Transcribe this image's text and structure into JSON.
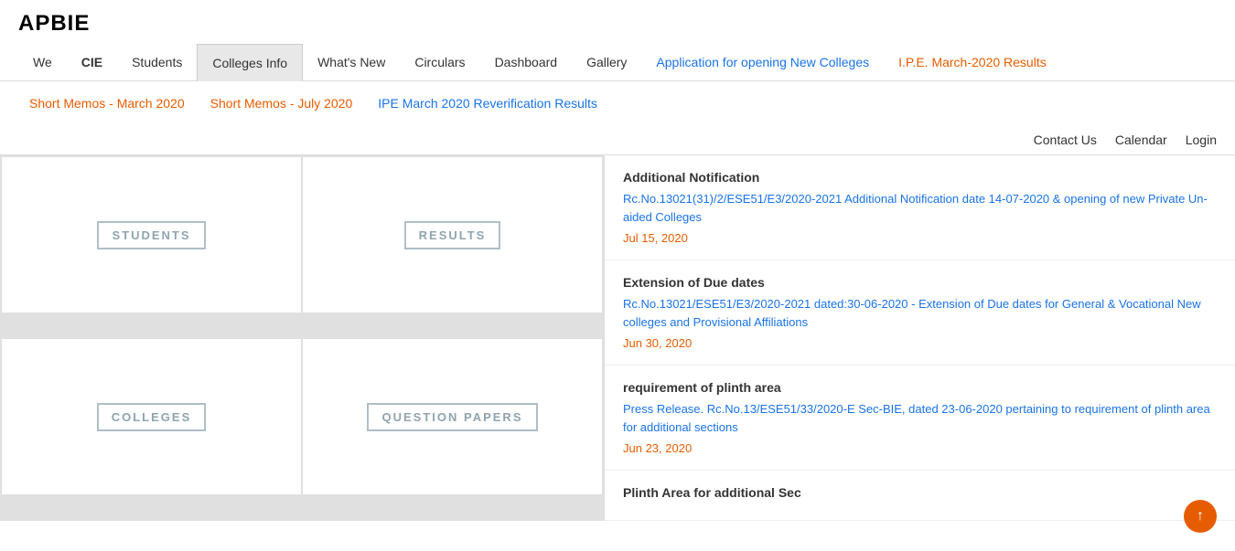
{
  "header": {
    "logo": "APBIE"
  },
  "primaryNav": {
    "items": [
      {
        "id": "we",
        "label": "We",
        "style": "normal",
        "active": false
      },
      {
        "id": "cie",
        "label": "CIE",
        "style": "bold",
        "active": false
      },
      {
        "id": "students",
        "label": "Students",
        "style": "normal",
        "active": false
      },
      {
        "id": "colleges-info",
        "label": "Colleges Info",
        "style": "normal",
        "active": true
      },
      {
        "id": "whats-new",
        "label": "What's New",
        "style": "normal",
        "active": false
      },
      {
        "id": "circulars",
        "label": "Circulars",
        "style": "normal",
        "active": false
      },
      {
        "id": "dashboard",
        "label": "Dashboard",
        "style": "normal",
        "active": false
      },
      {
        "id": "gallery",
        "label": "Gallery",
        "style": "normal",
        "active": false
      },
      {
        "id": "application-new-colleges",
        "label": "Application for opening New Colleges",
        "style": "blue",
        "active": false
      },
      {
        "id": "ipe-results",
        "label": "I.P.E. March-2020 Results",
        "style": "orange",
        "active": false
      }
    ]
  },
  "secondaryNav": {
    "items": [
      {
        "id": "short-memos-march",
        "label": "Short Memos - March 2020",
        "style": "orange"
      },
      {
        "id": "short-memos-july",
        "label": "Short Memos - July 2020",
        "style": "orange"
      },
      {
        "id": "ipe-reverification",
        "label": "IPE March 2020 Reverification Results",
        "style": "blue"
      }
    ]
  },
  "utilityNav": {
    "items": [
      {
        "id": "contact-us",
        "label": "Contact Us"
      },
      {
        "id": "calendar",
        "label": "Calendar"
      },
      {
        "id": "login",
        "label": "Login"
      }
    ]
  },
  "grid": {
    "cards": [
      {
        "id": "students",
        "label": "STUDENTS"
      },
      {
        "id": "results",
        "label": "RESULTS"
      },
      {
        "id": "colleges",
        "label": "COLLEGES"
      },
      {
        "id": "question-papers",
        "label": "QUESTION PAPERS"
      }
    ]
  },
  "news": {
    "items": [
      {
        "id": "additional-notification",
        "title": "Additional Notification",
        "desc": "Rc.No.13021(31)/2/ESE51/E3/2020-2021 Additional Notification date 14-07-2020 & opening of new Private Un-aided Colleges",
        "date": "Jul 15, 2020"
      },
      {
        "id": "extension-due-dates",
        "title": "Extension of Due dates",
        "desc": "Rc.No.13021/ESE51/E3/2020-2021 dated:30-06-2020 - Extension of Due dates for General & Vocational New colleges and Provisional Affiliations",
        "date": "Jun 30, 2020"
      },
      {
        "id": "requirement-plinth-area",
        "title": "requirement of plinth area",
        "desc": "Press Release. Rc.No.13/ESE51/33/2020-E Sec-BIE, dated 23-06-2020 pertaining to requirement of plinth area for additional sections",
        "date": "Jun 23, 2020"
      },
      {
        "id": "plinth-area-additional",
        "title": "Plinth Area for additional Sec",
        "desc": "",
        "date": ""
      }
    ]
  },
  "scrollBtn": {
    "icon": "↑"
  }
}
